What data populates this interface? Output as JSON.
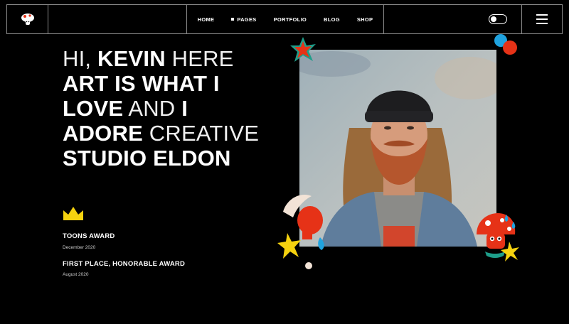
{
  "nav": {
    "items": [
      "HOME",
      "PAGES",
      "PORTFOLIO",
      "BLOG",
      "SHOP"
    ]
  },
  "hero": {
    "line1_a": "HI,",
    "line1_b": "KEVIN",
    "line1_c": "HERE",
    "line2": "ART IS WHAT I",
    "line3_a": "LOVE",
    "line3_b": "AND",
    "line3_c": "I",
    "line4_a": "ADORE",
    "line4_b": "CREATIVE",
    "line5": "STUDIO ELDON"
  },
  "awards": [
    {
      "title": "TOONS AWARD",
      "date": "December 2020"
    },
    {
      "title": "FIRST PLACE, HONORABLE AWARD",
      "date": "August 2020"
    }
  ],
  "colors": {
    "accent_red": "#e63217",
    "accent_yellow": "#f5d20f",
    "accent_blue": "#1fa3e0",
    "background": "#000000"
  },
  "icons": {
    "logo": "mushroom-logo-icon",
    "theme_toggle": "theme-toggle-icon",
    "menu": "hamburger-menu-icon",
    "crown": "crown-icon"
  }
}
